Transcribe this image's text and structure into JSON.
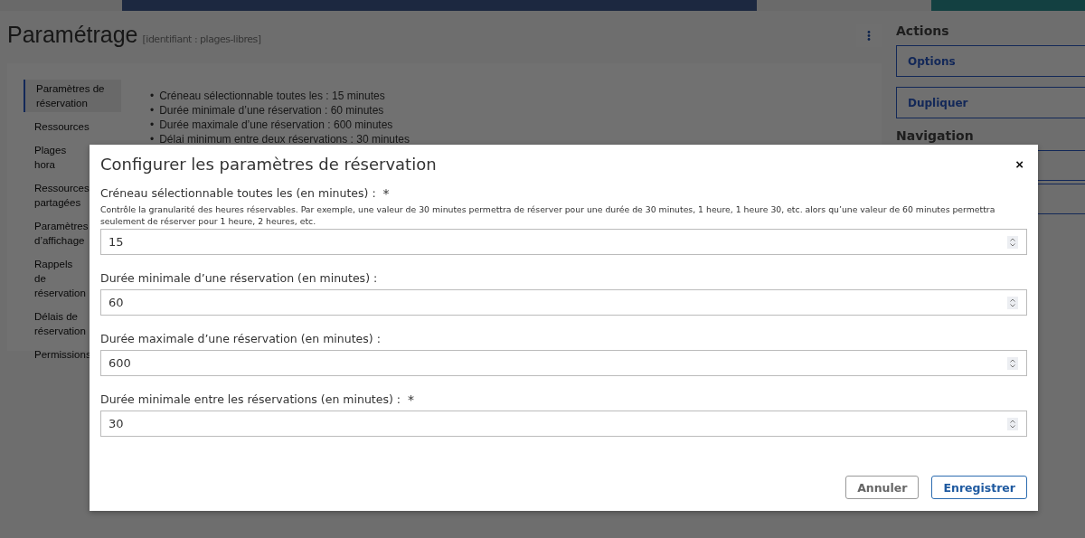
{
  "page": {
    "title": "Paramétrage",
    "identifier": "[identifiant : plages-libres]"
  },
  "sidebar": {
    "items": [
      {
        "label": "Paramètres de réservation",
        "selected": true
      },
      {
        "label": "Ressources",
        "selected": false
      },
      {
        "label": "Plages hora",
        "selected": false
      },
      {
        "label": "Ressources partagées",
        "selected": false
      },
      {
        "label": "Paramètres d’affichage",
        "selected": false
      },
      {
        "label": "Rappels de réservation",
        "selected": false
      },
      {
        "label": "Délais de réservation",
        "selected": false
      },
      {
        "label": "Permissions",
        "selected": false
      }
    ]
  },
  "summary_bullet": "•",
  "summary": [
    "Créneau sélectionnable toutes les : 15 minutes",
    "Durée minimale d’une réservation : 60 minutes",
    "Durée maximale d’une réservation : 600 minutes",
    "Délai minimum entre deux réservations : 30 minutes"
  ],
  "actions": {
    "title": "Actions",
    "buttons": [
      "Options",
      "Dupliquer"
    ]
  },
  "navigation": {
    "title": "Navigation"
  },
  "dialog": {
    "title": "Configurer les paramètres de réservation",
    "close": "×",
    "fields": [
      {
        "label": "Créneau sélectionnable toutes les (en minutes) :",
        "required": true,
        "help": "Contrôle la granularité des heures réservables. Par exemple, une valeur de 30 minutes permettra de réserver pour une durée de 30 minutes, 1 heure, 1 heure 30, etc. alors qu’une valeur de 60 minutes permettra seulement de réserver pour 1 heure, 2 heures, etc.",
        "value": "15"
      },
      {
        "label": "Durée minimale d’une réservation (en minutes) :",
        "required": false,
        "value": "60"
      },
      {
        "label": "Durée maximale d’une réservation (en minutes) :",
        "required": false,
        "value": "600"
      },
      {
        "label": "Durée minimale entre les réservations (en minutes) :",
        "required": true,
        "value": "30"
      }
    ],
    "required_mark": "*",
    "buttons": [
      {
        "label": "Annuler",
        "kind": "secondary"
      },
      {
        "label": "Enregistrer",
        "kind": "primary"
      }
    ]
  }
}
